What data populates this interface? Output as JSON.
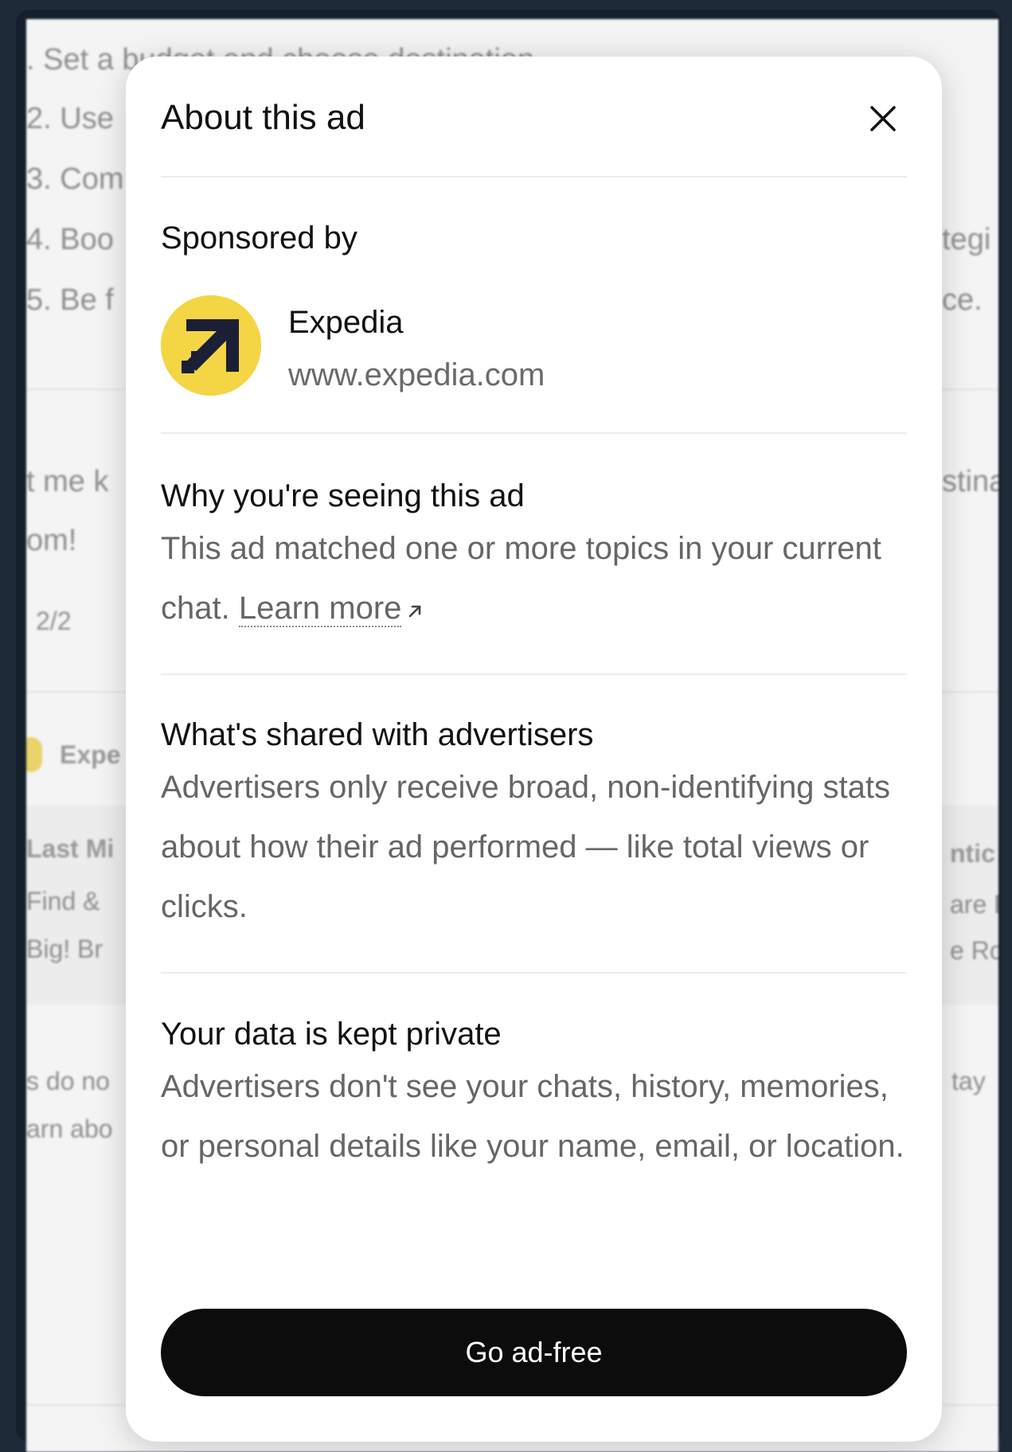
{
  "background": {
    "list_items": [
      ".  Set a budget and choose destination",
      "2.  Use",
      "3.  Com",
      "4.  Boo",
      "5.  Be f"
    ],
    "list_right_fragments": [
      "tegi",
      "ce."
    ],
    "message_left": [
      "t me k",
      "om!"
    ],
    "message_right": "stina",
    "pager": "2/2",
    "sponsor_fragment": "Expe",
    "card_left": [
      "Last Mi",
      "Find &",
      "Big! Br"
    ],
    "card_right": [
      "ntic",
      "are F",
      "e Ro"
    ],
    "footer_left": [
      "s do no",
      "arn abo"
    ],
    "footer_right": "tay"
  },
  "modal": {
    "title": "About this ad",
    "close_icon": "close-icon",
    "sponsored_by_label": "Sponsored by",
    "sponsor": {
      "name": "Expedia",
      "url": "www.expedia.com",
      "logo_color": "#f4d544",
      "logo_icon": "expedia-arrow-icon"
    },
    "why": {
      "title": "Why you're seeing this ad",
      "text": "This ad matched one or more topics in your current chat.",
      "link_label": "Learn more",
      "link_icon": "external-arrow-icon"
    },
    "shared": {
      "title": "What's shared with advertisers",
      "text": "Advertisers only receive broad, non-identifying stats about how their ad performed — like total views or clicks."
    },
    "private": {
      "title": "Your data is kept private",
      "text": "Advertisers don't see your chats, history, memories, or personal details like your name, email, or location."
    },
    "cta_label": "Go ad-free"
  }
}
